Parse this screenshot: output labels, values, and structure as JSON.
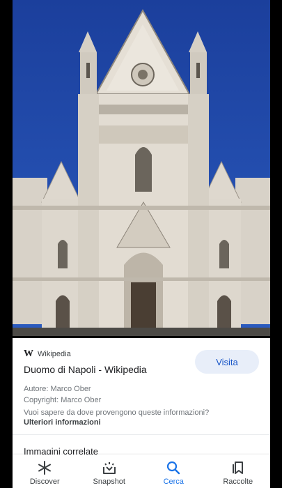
{
  "image": {
    "subject_icon": "cathedral-photo"
  },
  "result": {
    "source_logo": "W",
    "source_name": "Wikipedia",
    "title": "Duomo di Napoli - Wikipedia",
    "visit_label": "Visita",
    "author": "Autore: Marco Ober",
    "copyright": "Copyright: Marco Ober",
    "info_question": "Vuoi sapere da dove provengono queste informazioni?",
    "more_info": "Ulteriori informazioni",
    "related_heading": "Immagini correlate"
  },
  "nav": {
    "items": [
      {
        "label": "Discover",
        "icon": "asterisk-icon"
      },
      {
        "label": "Snapshot",
        "icon": "snapshot-icon"
      },
      {
        "label": "Cerca",
        "icon": "search-icon"
      },
      {
        "label": "Raccolte",
        "icon": "collections-icon"
      }
    ],
    "active_index": 2
  },
  "colors": {
    "accent": "#1a73e8",
    "visit_bg": "#e8eef9",
    "sky": "#1f4aa6"
  }
}
